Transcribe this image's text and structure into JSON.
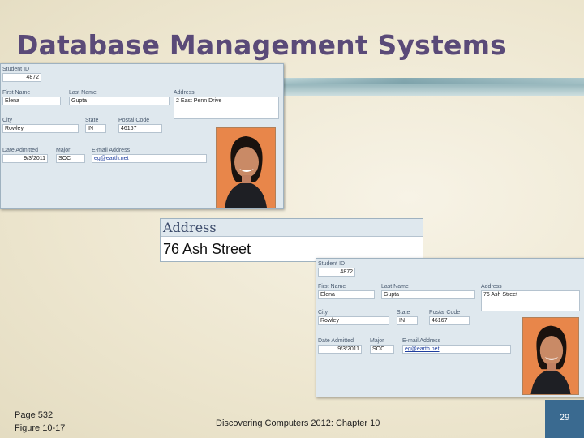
{
  "slide": {
    "title": "Database Management Systems",
    "page_ref": "Page 532",
    "figure_ref": "Figure 10-17",
    "footer": "Discovering Computers 2012: Chapter 10",
    "page_number": "29"
  },
  "form_before": {
    "student_id": {
      "label": "Student ID",
      "value": "4872"
    },
    "first_name": {
      "label": "First Name",
      "value": "Elena"
    },
    "last_name": {
      "label": "Last Name",
      "value": "Gupta"
    },
    "address": {
      "label": "Address",
      "value": "2 East Penn Drive"
    },
    "city": {
      "label": "City",
      "value": "Rowley"
    },
    "state": {
      "label": "State",
      "value": "IN"
    },
    "postal_code": {
      "label": "Postal Code",
      "value": "46167"
    },
    "date_admitted": {
      "label": "Date Admitted",
      "value": "9/3/2011"
    },
    "major": {
      "label": "Major",
      "value": "SOC"
    },
    "email": {
      "label": "E-mail Address",
      "value": "eg@earth.net"
    }
  },
  "zoom_field": {
    "label": "Address",
    "value": "76 Ash Street"
  },
  "form_after": {
    "student_id": {
      "label": "Student ID",
      "value": "4872"
    },
    "first_name": {
      "label": "First Name",
      "value": "Elena"
    },
    "last_name": {
      "label": "Last Name",
      "value": "Gupta"
    },
    "address": {
      "label": "Address",
      "value": "76 Ash Street"
    },
    "city": {
      "label": "City",
      "value": "Rowley"
    },
    "state": {
      "label": "State",
      "value": "IN"
    },
    "postal_code": {
      "label": "Postal Code",
      "value": "46167"
    },
    "date_admitted": {
      "label": "Date Admitted",
      "value": "9/3/2011"
    },
    "major": {
      "label": "Major",
      "value": "SOC"
    },
    "email": {
      "label": "E-mail Address",
      "value": "eg@earth.net"
    }
  },
  "colors": {
    "title": "#5a4a78",
    "page_badge": "#3a6a90",
    "form_bg": "#dfe8ee"
  }
}
